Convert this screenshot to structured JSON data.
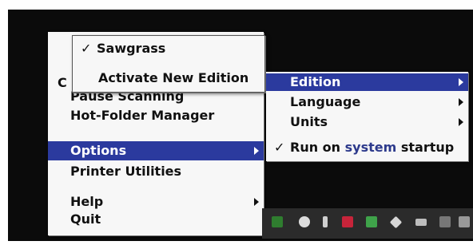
{
  "main_menu": {
    "items": [
      {
        "label": "Pause Scanning"
      },
      {
        "label": "Hot-Folder Manager"
      },
      {
        "label": "Options"
      },
      {
        "label": "Printer Utilities"
      },
      {
        "label": "Help"
      },
      {
        "label": "Quit"
      }
    ],
    "partial_label": "C"
  },
  "edition_menu": {
    "check": "✓",
    "selected_label": "Sawgrass",
    "activate_label": "Activate New Edition"
  },
  "options_submenu": {
    "edition_label": "Edition",
    "language_label": "Language",
    "units_label": "Units",
    "run_check": "✓",
    "run_label_prefix": "Run on ",
    "run_label_highlight": "system",
    "run_label_suffix": " startup"
  },
  "tray": {
    "icons": [
      "monitor-icon",
      "app-icon",
      "bluetooth-icon",
      "shield-icon",
      "nvidia-icon",
      "dropbox-icon",
      "battery-icon",
      "network-icon",
      "volume-icon"
    ]
  },
  "colors": {
    "selection": "#2b3a9e",
    "menu_bg": "#f7f7f7",
    "desktop": "#0b0b0b",
    "taskbar": "#2b2b2b"
  }
}
